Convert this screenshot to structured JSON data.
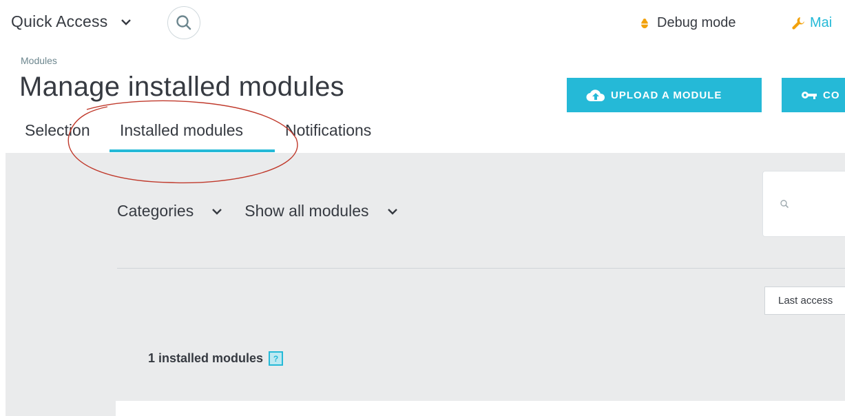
{
  "header": {
    "quick_access_label": "Quick Access",
    "debug_mode_label": "Debug mode",
    "maintenance_label": "Mai"
  },
  "breadcrumb": "Modules",
  "page_title": "Manage installed modules",
  "toolbar": {
    "upload_label": "UPLOAD A MODULE",
    "connect_label": "CO"
  },
  "tabs": [
    {
      "label": "Selection",
      "active": false
    },
    {
      "label": "Installed modules",
      "active": true
    },
    {
      "label": "Notifications",
      "active": false
    }
  ],
  "filters": {
    "categories_label": "Categories",
    "show_label": "Show all modules"
  },
  "sort": {
    "selected": "Last access"
  },
  "modules_count_label": "1 installed modules",
  "help_label": "?",
  "colors": {
    "accent": "#25b9d7",
    "annotation": "#c0392b",
    "content_bg": "#eaebec"
  }
}
